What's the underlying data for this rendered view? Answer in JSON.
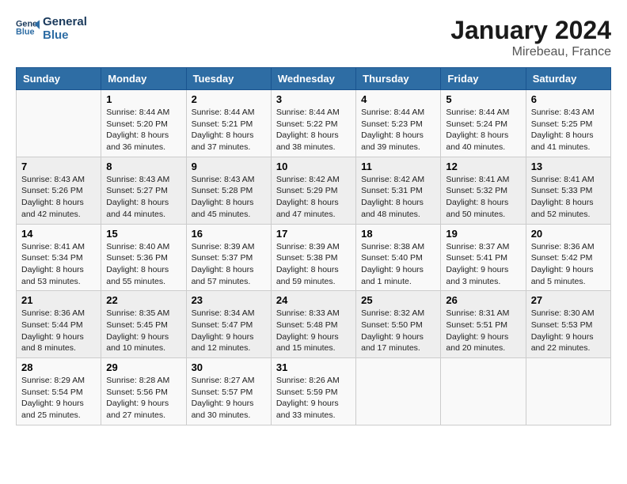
{
  "logo": {
    "text_general": "General",
    "text_blue": "Blue"
  },
  "title": "January 2024",
  "location": "Mirebeau, France",
  "days_header": [
    "Sunday",
    "Monday",
    "Tuesday",
    "Wednesday",
    "Thursday",
    "Friday",
    "Saturday"
  ],
  "weeks": [
    [
      {
        "day": "",
        "info": ""
      },
      {
        "day": "1",
        "info": "Sunrise: 8:44 AM\nSunset: 5:20 PM\nDaylight: 8 hours\nand 36 minutes."
      },
      {
        "day": "2",
        "info": "Sunrise: 8:44 AM\nSunset: 5:21 PM\nDaylight: 8 hours\nand 37 minutes."
      },
      {
        "day": "3",
        "info": "Sunrise: 8:44 AM\nSunset: 5:22 PM\nDaylight: 8 hours\nand 38 minutes."
      },
      {
        "day": "4",
        "info": "Sunrise: 8:44 AM\nSunset: 5:23 PM\nDaylight: 8 hours\nand 39 minutes."
      },
      {
        "day": "5",
        "info": "Sunrise: 8:44 AM\nSunset: 5:24 PM\nDaylight: 8 hours\nand 40 minutes."
      },
      {
        "day": "6",
        "info": "Sunrise: 8:43 AM\nSunset: 5:25 PM\nDaylight: 8 hours\nand 41 minutes."
      }
    ],
    [
      {
        "day": "7",
        "info": "Sunrise: 8:43 AM\nSunset: 5:26 PM\nDaylight: 8 hours\nand 42 minutes."
      },
      {
        "day": "8",
        "info": "Sunrise: 8:43 AM\nSunset: 5:27 PM\nDaylight: 8 hours\nand 44 minutes."
      },
      {
        "day": "9",
        "info": "Sunrise: 8:43 AM\nSunset: 5:28 PM\nDaylight: 8 hours\nand 45 minutes."
      },
      {
        "day": "10",
        "info": "Sunrise: 8:42 AM\nSunset: 5:29 PM\nDaylight: 8 hours\nand 47 minutes."
      },
      {
        "day": "11",
        "info": "Sunrise: 8:42 AM\nSunset: 5:31 PM\nDaylight: 8 hours\nand 48 minutes."
      },
      {
        "day": "12",
        "info": "Sunrise: 8:41 AM\nSunset: 5:32 PM\nDaylight: 8 hours\nand 50 minutes."
      },
      {
        "day": "13",
        "info": "Sunrise: 8:41 AM\nSunset: 5:33 PM\nDaylight: 8 hours\nand 52 minutes."
      }
    ],
    [
      {
        "day": "14",
        "info": "Sunrise: 8:41 AM\nSunset: 5:34 PM\nDaylight: 8 hours\nand 53 minutes."
      },
      {
        "day": "15",
        "info": "Sunrise: 8:40 AM\nSunset: 5:36 PM\nDaylight: 8 hours\nand 55 minutes."
      },
      {
        "day": "16",
        "info": "Sunrise: 8:39 AM\nSunset: 5:37 PM\nDaylight: 8 hours\nand 57 minutes."
      },
      {
        "day": "17",
        "info": "Sunrise: 8:39 AM\nSunset: 5:38 PM\nDaylight: 8 hours\nand 59 minutes."
      },
      {
        "day": "18",
        "info": "Sunrise: 8:38 AM\nSunset: 5:40 PM\nDaylight: 9 hours\nand 1 minute."
      },
      {
        "day": "19",
        "info": "Sunrise: 8:37 AM\nSunset: 5:41 PM\nDaylight: 9 hours\nand 3 minutes."
      },
      {
        "day": "20",
        "info": "Sunrise: 8:36 AM\nSunset: 5:42 PM\nDaylight: 9 hours\nand 5 minutes."
      }
    ],
    [
      {
        "day": "21",
        "info": "Sunrise: 8:36 AM\nSunset: 5:44 PM\nDaylight: 9 hours\nand 8 minutes."
      },
      {
        "day": "22",
        "info": "Sunrise: 8:35 AM\nSunset: 5:45 PM\nDaylight: 9 hours\nand 10 minutes."
      },
      {
        "day": "23",
        "info": "Sunrise: 8:34 AM\nSunset: 5:47 PM\nDaylight: 9 hours\nand 12 minutes."
      },
      {
        "day": "24",
        "info": "Sunrise: 8:33 AM\nSunset: 5:48 PM\nDaylight: 9 hours\nand 15 minutes."
      },
      {
        "day": "25",
        "info": "Sunrise: 8:32 AM\nSunset: 5:50 PM\nDaylight: 9 hours\nand 17 minutes."
      },
      {
        "day": "26",
        "info": "Sunrise: 8:31 AM\nSunset: 5:51 PM\nDaylight: 9 hours\nand 20 minutes."
      },
      {
        "day": "27",
        "info": "Sunrise: 8:30 AM\nSunset: 5:53 PM\nDaylight: 9 hours\nand 22 minutes."
      }
    ],
    [
      {
        "day": "28",
        "info": "Sunrise: 8:29 AM\nSunset: 5:54 PM\nDaylight: 9 hours\nand 25 minutes."
      },
      {
        "day": "29",
        "info": "Sunrise: 8:28 AM\nSunset: 5:56 PM\nDaylight: 9 hours\nand 27 minutes."
      },
      {
        "day": "30",
        "info": "Sunrise: 8:27 AM\nSunset: 5:57 PM\nDaylight: 9 hours\nand 30 minutes."
      },
      {
        "day": "31",
        "info": "Sunrise: 8:26 AM\nSunset: 5:59 PM\nDaylight: 9 hours\nand 33 minutes."
      },
      {
        "day": "",
        "info": ""
      },
      {
        "day": "",
        "info": ""
      },
      {
        "day": "",
        "info": ""
      }
    ]
  ]
}
